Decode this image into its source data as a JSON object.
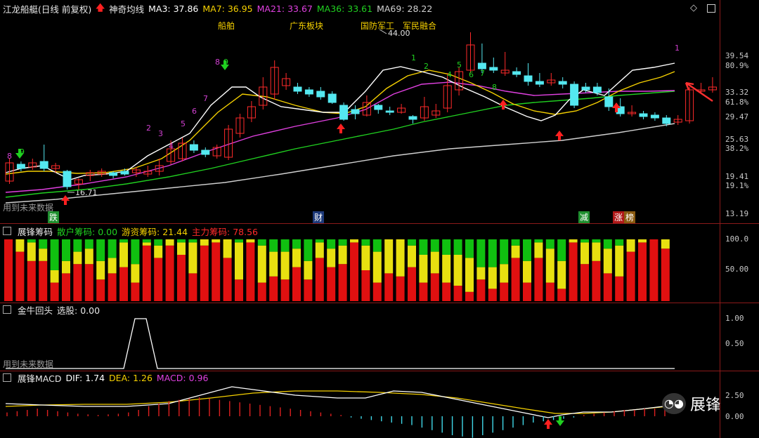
{
  "main": {
    "title": "江龙船艇(日线 前复权)",
    "indicator": "神奇均线",
    "ma": [
      {
        "label": "MA3: 37.86",
        "color": "#ffffff"
      },
      {
        "label": "MA7: 36.95",
        "color": "#f5d000"
      },
      {
        "label": "MA21: 33.67",
        "color": "#e040e0"
      },
      {
        "label": "MA36: 33.61",
        "color": "#20d020"
      },
      {
        "label": "MA69: 28.22",
        "color": "#d0d0d0"
      }
    ],
    "concepts": [
      "船舶",
      "广东板块",
      "国防军工",
      "军民融合"
    ],
    "high_label": "44.00",
    "low_label": "16.71",
    "future_note": "用到未来数据",
    "events": [
      "跌",
      "财",
      "减",
      "涨",
      "榜"
    ],
    "price_ticks": [
      "39.54",
      "80.9%",
      "33.32",
      "61.8%",
      "29.47",
      "25.63",
      "38.2%",
      "19.41",
      "19.1%",
      "13.19"
    ]
  },
  "chips": {
    "title": "展锋筹码",
    "retail": "散户筹码: 0.00",
    "hot": "游资筹码: 21.44",
    "main": "主力筹码: 78.56",
    "ticks": [
      "100.0",
      "50.00"
    ]
  },
  "jnht": {
    "title": "金牛回头",
    "pick": "选股: 0.00",
    "future_note": "用到未来数据",
    "ticks": [
      "1.00",
      "0.50"
    ]
  },
  "macd": {
    "title": "展锋MACD",
    "dif": "DIF: 1.74",
    "dea": "DEA: 1.26",
    "macd": "MACD: 0.96",
    "ticks": [
      "2.50",
      "0.00"
    ]
  },
  "watermark": "展锋"
}
